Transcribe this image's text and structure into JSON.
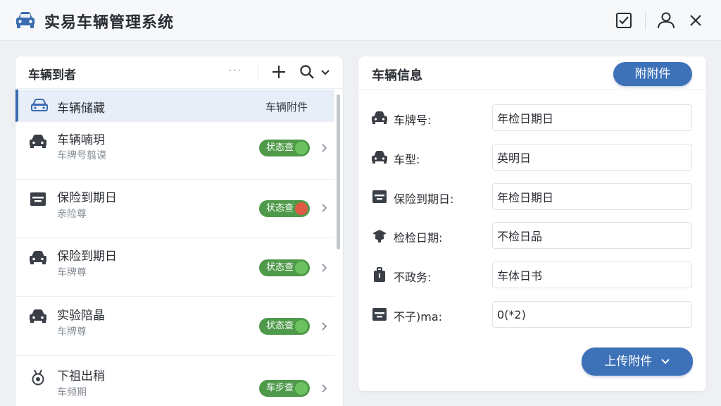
{
  "app": {
    "title": "实易车辆管理系统"
  },
  "left_panel": {
    "title": "车辆到者",
    "more": "···",
    "items": [
      {
        "title": "车辆储藏",
        "right_text": "车辆附件",
        "icon": "car-icon"
      },
      {
        "title": "车辆喃玥",
        "subtitle": "车牌号翦谟",
        "badge": "状态查",
        "badge_status": "green",
        "icon": "car-icon"
      },
      {
        "title": "保险到期日",
        "subtitle": "亲险尊",
        "badge": "状态查",
        "badge_status": "red",
        "icon": "calendar-icon"
      },
      {
        "title": "保险到期日",
        "subtitle": "车牌尊",
        "badge": "状态查",
        "badge_status": "green-check",
        "icon": "car-icon"
      },
      {
        "title": "实验陪晶",
        "subtitle": "车牌尊",
        "badge": "状态查",
        "badge_status": "green",
        "icon": "car-icon"
      },
      {
        "title": "下祖出稍",
        "subtitle": "车频期",
        "badge": "车步查",
        "badge_status": "green",
        "icon": "medal-icon"
      }
    ]
  },
  "right_panel": {
    "title": "车辆信息",
    "attach_button": "附附件",
    "upload_button": "上传附件",
    "fields": [
      {
        "label": "车牌号:",
        "value": "年检日期日",
        "icon": "car-icon"
      },
      {
        "label": "车型:",
        "value": "英明日",
        "icon": "car-icon"
      },
      {
        "label": "保险到期日:",
        "value": "年检日期日",
        "icon": "calendar-icon"
      },
      {
        "label": "检检日期:",
        "value": "不检日品",
        "icon": "inspection-icon"
      },
      {
        "label": "不政务:",
        "value": "车体日书",
        "icon": "bag-icon"
      },
      {
        "label": "不子)ma:",
        "value": "0(*2)",
        "icon": "calendar-icon"
      }
    ]
  },
  "colors": {
    "accent": "#3d71b8",
    "selected_bg": "#e8eef8",
    "badge_green": "#4f9a4a",
    "badge_red": "#e05a43"
  }
}
